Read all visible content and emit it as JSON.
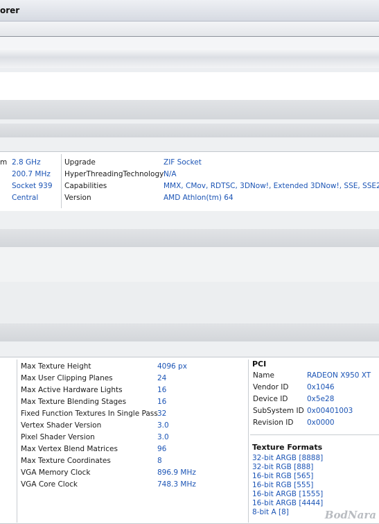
{
  "window": {
    "title": "orer"
  },
  "cpu": {
    "left_rows": [
      {
        "label": "m",
        "value": "2.8 GHz"
      },
      {
        "label": "",
        "value": "200.7 MHz"
      },
      {
        "label": "",
        "value": "Socket 939"
      },
      {
        "label": "",
        "value": "Central"
      }
    ],
    "right_rows": [
      {
        "label": "Upgrade",
        "value": "ZIF Socket"
      },
      {
        "label": "HyperThreadingTechnology",
        "value": "N/A"
      },
      {
        "label": "Capabilities",
        "value": "MMX, CMov, RDTSC, 3DNow!, Extended 3DNow!, SSE, SSE2, SS"
      },
      {
        "label": "Version",
        "value": "AMD Athlon(tm) 64"
      }
    ]
  },
  "gpu": {
    "rows": [
      {
        "label": "Max Texture Height",
        "value": "4096 px"
      },
      {
        "label": "Max User Clipping Planes",
        "value": "24"
      },
      {
        "label": "Max Active Hardware Lights",
        "value": "16"
      },
      {
        "label": "Max Texture Blending Stages",
        "value": "16"
      },
      {
        "label": "Fixed Function Textures In Single Pass",
        "value": "32"
      },
      {
        "label": "Vertex Shader Version",
        "value": "3.0"
      },
      {
        "label": "Pixel Shader Version",
        "value": "3.0"
      },
      {
        "label": "Max Vertex Blend Matrices",
        "value": "96"
      },
      {
        "label": "Max Texture Coordinates",
        "value": "8"
      },
      {
        "label": "VGA Memory Clock",
        "value": "896.9 MHz"
      },
      {
        "label": "VGA Core Clock",
        "value": "748.3 MHz"
      }
    ],
    "pci": {
      "heading": "PCI",
      "rows": [
        {
          "label": "Name",
          "value": "RADEON X950 XT"
        },
        {
          "label": "Vendor ID",
          "value": "0x1046"
        },
        {
          "label": "Device ID",
          "value": "0x5e28"
        },
        {
          "label": "SubSystem ID",
          "value": "0x00401003"
        },
        {
          "label": "Revision ID",
          "value": "0x0000"
        }
      ]
    },
    "texture_formats": {
      "heading": "Texture Formats",
      "items": [
        "32-bit ARGB [8888]",
        "32-bit RGB [888]",
        "16-bit RGB [565]",
        "16-bit RGB [555]",
        "16-bit ARGB [1555]",
        "16-bit ARGB [4444]",
        "8-bit A [8]"
      ]
    }
  },
  "watermark": "BodNara"
}
